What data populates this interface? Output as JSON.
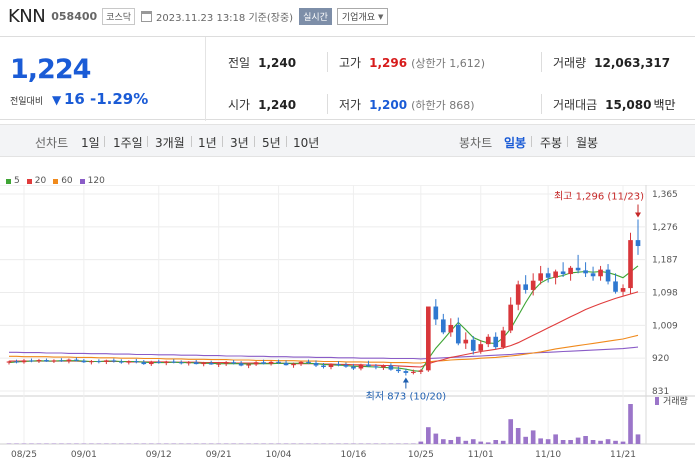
{
  "header": {
    "stock_name": "KNN",
    "stock_code": "058400",
    "market_badge": "코스닥",
    "date_text": "2023.11.23 13:18  기준(장중)",
    "realtime_label": "실시간",
    "company_label": "기업개요"
  },
  "summary": {
    "current_price": "1,224",
    "compare_label": "전일대비",
    "change_arrow": "▼",
    "change_value": "16",
    "change_rate": "-1.29%",
    "prev_close_label": "전일",
    "prev_close": "1,240",
    "high_label": "고가",
    "high": "1,296",
    "upper_limit": "(상한가 1,612)",
    "volume_label": "거래량",
    "volume": "12,063,317",
    "open_label": "시가",
    "open": "1,240",
    "low_label": "저가",
    "low": "1,200",
    "lower_limit": "(하한가 868)",
    "amount_label": "거래대금",
    "amount": "15,080",
    "amount_unit": "백만"
  },
  "toolbar": {
    "line_chart_label": "선차트",
    "line_periods": [
      "1일",
      "1주일",
      "3개월",
      "1년",
      "3년",
      "5년",
      "10년"
    ],
    "candle_chart_label": "봉차트",
    "candle_periods": [
      "일봉",
      "주봉",
      "월봉"
    ],
    "active_candle_period": "일봉"
  },
  "legend": [
    {
      "label": "5",
      "color": "#3fa535"
    },
    {
      "label": "20",
      "color": "#e03c3c"
    },
    {
      "label": "60",
      "color": "#f08a1c"
    },
    {
      "label": "120",
      "color": "#8a5cc7"
    }
  ],
  "chart_data": {
    "type": "candlestick",
    "y_ticks": [
      "1,365",
      "1,276",
      "1,187",
      "1,098",
      "1,009",
      "920",
      "831"
    ],
    "ylim": [
      831,
      1365
    ],
    "x_ticks": [
      "08/25",
      "09/01",
      "09/12",
      "09/21",
      "10/04",
      "10/16",
      "10/25",
      "11/01",
      "11/10",
      "11/21"
    ],
    "high_annotation": "최고 1,296 (11/23)",
    "low_annotation": "최저 873 (10/20)",
    "volume_label": "거래량",
    "up_color": "#d8363a",
    "down_color": "#2f78d0",
    "volume_color": "#9b75c9",
    "candles": [
      [
        0,
        908,
        913,
        903,
        911
      ],
      [
        1,
        911,
        916,
        906,
        909
      ],
      [
        2,
        909,
        918,
        905,
        914
      ],
      [
        3,
        914,
        919,
        909,
        912
      ],
      [
        4,
        912,
        918,
        907,
        915
      ],
      [
        5,
        915,
        919,
        910,
        911
      ],
      [
        6,
        911,
        917,
        907,
        914
      ],
      [
        7,
        914,
        920,
        910,
        912
      ],
      [
        8,
        912,
        919,
        906,
        916
      ],
      [
        9,
        916,
        922,
        911,
        913
      ],
      [
        10,
        913,
        918,
        907,
        909
      ],
      [
        11,
        909,
        915,
        903,
        912
      ],
      [
        12,
        912,
        917,
        906,
        910
      ],
      [
        13,
        910,
        916,
        904,
        914
      ],
      [
        14,
        914,
        919,
        908,
        911
      ],
      [
        15,
        911,
        917,
        905,
        908
      ],
      [
        16,
        908,
        914,
        903,
        912
      ],
      [
        17,
        912,
        918,
        906,
        909
      ],
      [
        18,
        909,
        915,
        902,
        904
      ],
      [
        19,
        904,
        913,
        899,
        910
      ],
      [
        20,
        910,
        916,
        905,
        907
      ],
      [
        21,
        907,
        913,
        901,
        911
      ],
      [
        22,
        911,
        917,
        906,
        909
      ],
      [
        23,
        909,
        914,
        903,
        906
      ],
      [
        24,
        906,
        912,
        900,
        909
      ],
      [
        25,
        909,
        915,
        903,
        904
      ],
      [
        26,
        904,
        910,
        898,
        907
      ],
      [
        27,
        907,
        913,
        902,
        903
      ],
      [
        28,
        903,
        909,
        896,
        905
      ],
      [
        29,
        905,
        912,
        899,
        909
      ],
      [
        30,
        909,
        915,
        903,
        906
      ],
      [
        31,
        906,
        912,
        898,
        900
      ],
      [
        32,
        900,
        906,
        893,
        903
      ],
      [
        33,
        903,
        912,
        899,
        909
      ],
      [
        34,
        909,
        916,
        903,
        905
      ],
      [
        35,
        905,
        913,
        900,
        910
      ],
      [
        36,
        910,
        916,
        904,
        907
      ],
      [
        37,
        907,
        914,
        900,
        901
      ],
      [
        38,
        901,
        908,
        894,
        905
      ],
      [
        39,
        905,
        912,
        899,
        910
      ],
      [
        40,
        910,
        916,
        904,
        907
      ],
      [
        41,
        907,
        914,
        896,
        900
      ],
      [
        42,
        900,
        907,
        892,
        896
      ],
      [
        43,
        896,
        906,
        890,
        904
      ],
      [
        44,
        904,
        912,
        898,
        902
      ],
      [
        45,
        902,
        908,
        894,
        897
      ],
      [
        46,
        897,
        904,
        888,
        892
      ],
      [
        47,
        892,
        905,
        887,
        903
      ],
      [
        48,
        903,
        913,
        896,
        898
      ],
      [
        49,
        898,
        904,
        890,
        895
      ],
      [
        50,
        895,
        903,
        888,
        900
      ],
      [
        51,
        900,
        906,
        886,
        889
      ],
      [
        52,
        889,
        897,
        880,
        885
      ],
      [
        53,
        885,
        892,
        873,
        880
      ],
      [
        54,
        880,
        889,
        876,
        883
      ],
      [
        55,
        883,
        890,
        877,
        887
      ],
      [
        56,
        887,
        915,
        883,
        1060
      ],
      [
        57,
        1060,
        1080,
        1010,
        1025
      ],
      [
        58,
        1025,
        1040,
        985,
        990
      ],
      [
        59,
        990,
        1028,
        978,
        1010
      ],
      [
        60,
        1010,
        1030,
        955,
        960
      ],
      [
        61,
        960,
        990,
        945,
        970
      ],
      [
        62,
        970,
        980,
        930,
        940
      ],
      [
        63,
        940,
        968,
        932,
        958
      ],
      [
        64,
        958,
        985,
        950,
        978
      ],
      [
        65,
        978,
        990,
        945,
        950
      ],
      [
        66,
        950,
        1005,
        945,
        995
      ],
      [
        67,
        995,
        1085,
        988,
        1065
      ],
      [
        68,
        1065,
        1130,
        1050,
        1120
      ],
      [
        69,
        1120,
        1145,
        1095,
        1105
      ],
      [
        70,
        1105,
        1150,
        1090,
        1130
      ],
      [
        71,
        1130,
        1170,
        1120,
        1150
      ],
      [
        72,
        1150,
        1165,
        1125,
        1138
      ],
      [
        73,
        1138,
        1160,
        1120,
        1155
      ],
      [
        74,
        1155,
        1180,
        1140,
        1148
      ],
      [
        75,
        1148,
        1170,
        1130,
        1165
      ],
      [
        76,
        1165,
        1200,
        1150,
        1158
      ],
      [
        77,
        1158,
        1180,
        1140,
        1150
      ],
      [
        78,
        1150,
        1168,
        1130,
        1142
      ],
      [
        79,
        1142,
        1170,
        1130,
        1160
      ],
      [
        80,
        1160,
        1175,
        1120,
        1128
      ],
      [
        81,
        1128,
        1150,
        1095,
        1100
      ],
      [
        82,
        1100,
        1120,
        1090,
        1110
      ],
      [
        83,
        1110,
        1260,
        1095,
        1240
      ],
      [
        84,
        1240,
        1296,
        1200,
        1224
      ]
    ],
    "ma5": [
      908,
      910,
      911,
      912,
      913,
      912,
      912,
      913,
      913,
      913,
      912,
      911,
      911,
      912,
      912,
      911,
      911,
      911,
      909,
      908,
      908,
      908,
      909,
      908,
      908,
      907,
      906,
      906,
      905,
      905,
      905,
      905,
      904,
      905,
      905,
      905,
      906,
      906,
      906,
      906,
      906,
      905,
      903,
      902,
      901,
      900,
      898,
      898,
      897,
      896,
      895,
      894,
      893,
      890,
      886,
      884,
      918,
      947,
      970,
      994,
      1017,
      997,
      976,
      967,
      961,
      960,
      975,
      1000,
      1035,
      1071,
      1103,
      1124,
      1135,
      1140,
      1144,
      1151,
      1153,
      1155,
      1153,
      1155,
      1152,
      1146,
      1138,
      1154,
      1170
    ],
    "ma20": [
      912,
      912,
      912,
      912,
      912,
      912,
      912,
      912,
      912,
      912,
      911,
      911,
      911,
      911,
      911,
      911,
      910,
      910,
      910,
      910,
      910,
      910,
      909,
      909,
      909,
      909,
      908,
      908,
      908,
      908,
      907,
      907,
      907,
      907,
      906,
      906,
      906,
      906,
      905,
      905,
      905,
      905,
      904,
      904,
      903,
      903,
      902,
      902,
      901,
      901,
      900,
      900,
      899,
      898,
      897,
      896,
      905,
      911,
      916,
      922,
      926,
      930,
      934,
      938,
      941,
      944,
      948,
      954,
      962,
      972,
      982,
      992,
      1002,
      1012,
      1022,
      1032,
      1042,
      1052,
      1060,
      1068,
      1075,
      1082,
      1088,
      1094,
      1100
    ],
    "ma60": [
      925,
      925,
      924,
      924,
      924,
      924,
      923,
      923,
      923,
      922,
      922,
      922,
      921,
      921,
      921,
      920,
      920,
      920,
      919,
      919,
      919,
      918,
      918,
      918,
      917,
      917,
      917,
      916,
      916,
      916,
      915,
      915,
      915,
      914,
      914,
      914,
      913,
      913,
      913,
      912,
      912,
      912,
      911,
      911,
      911,
      910,
      910,
      910,
      909,
      909,
      909,
      908,
      908,
      908,
      907,
      907,
      910,
      912,
      913,
      915,
      916,
      917,
      918,
      920,
      921,
      922,
      924,
      926,
      928,
      931,
      934,
      937,
      941,
      945,
      948,
      951,
      954,
      957,
      960,
      963,
      966,
      969,
      972,
      977,
      982
    ],
    "ma120": [
      936,
      936,
      935,
      935,
      935,
      934,
      934,
      934,
      933,
      933,
      933,
      932,
      932,
      932,
      931,
      931,
      931,
      930,
      930,
      930,
      929,
      929,
      929,
      928,
      928,
      928,
      927,
      927,
      927,
      926,
      926,
      926,
      925,
      925,
      925,
      924,
      924,
      924,
      923,
      923,
      923,
      922,
      922,
      922,
      921,
      921,
      921,
      920,
      920,
      920,
      920,
      919,
      919,
      919,
      919,
      918,
      919,
      920,
      921,
      922,
      923,
      924,
      925,
      926,
      927,
      928,
      929,
      930,
      932,
      933,
      934,
      935,
      936,
      937,
      938,
      939,
      940,
      941,
      942,
      943,
      944,
      945,
      946,
      948,
      950
    ],
    "volumes": [
      1,
      1,
      1,
      1,
      1,
      1,
      1,
      1,
      1,
      1,
      1,
      1,
      1,
      1,
      1,
      1,
      1,
      1,
      1,
      1,
      1,
      1,
      1,
      1,
      1,
      1,
      1,
      1,
      1,
      1,
      1,
      1,
      1,
      1,
      1,
      1,
      1,
      1,
      1,
      1,
      1,
      1,
      1,
      1,
      1,
      1,
      1,
      1,
      1,
      1,
      1,
      1,
      1,
      1,
      1,
      6,
      42,
      26,
      12,
      10,
      18,
      8,
      12,
      6,
      4,
      10,
      8,
      62,
      40,
      18,
      34,
      14,
      12,
      24,
      10,
      10,
      16,
      20,
      10,
      8,
      12,
      8,
      6,
      100,
      24
    ]
  }
}
